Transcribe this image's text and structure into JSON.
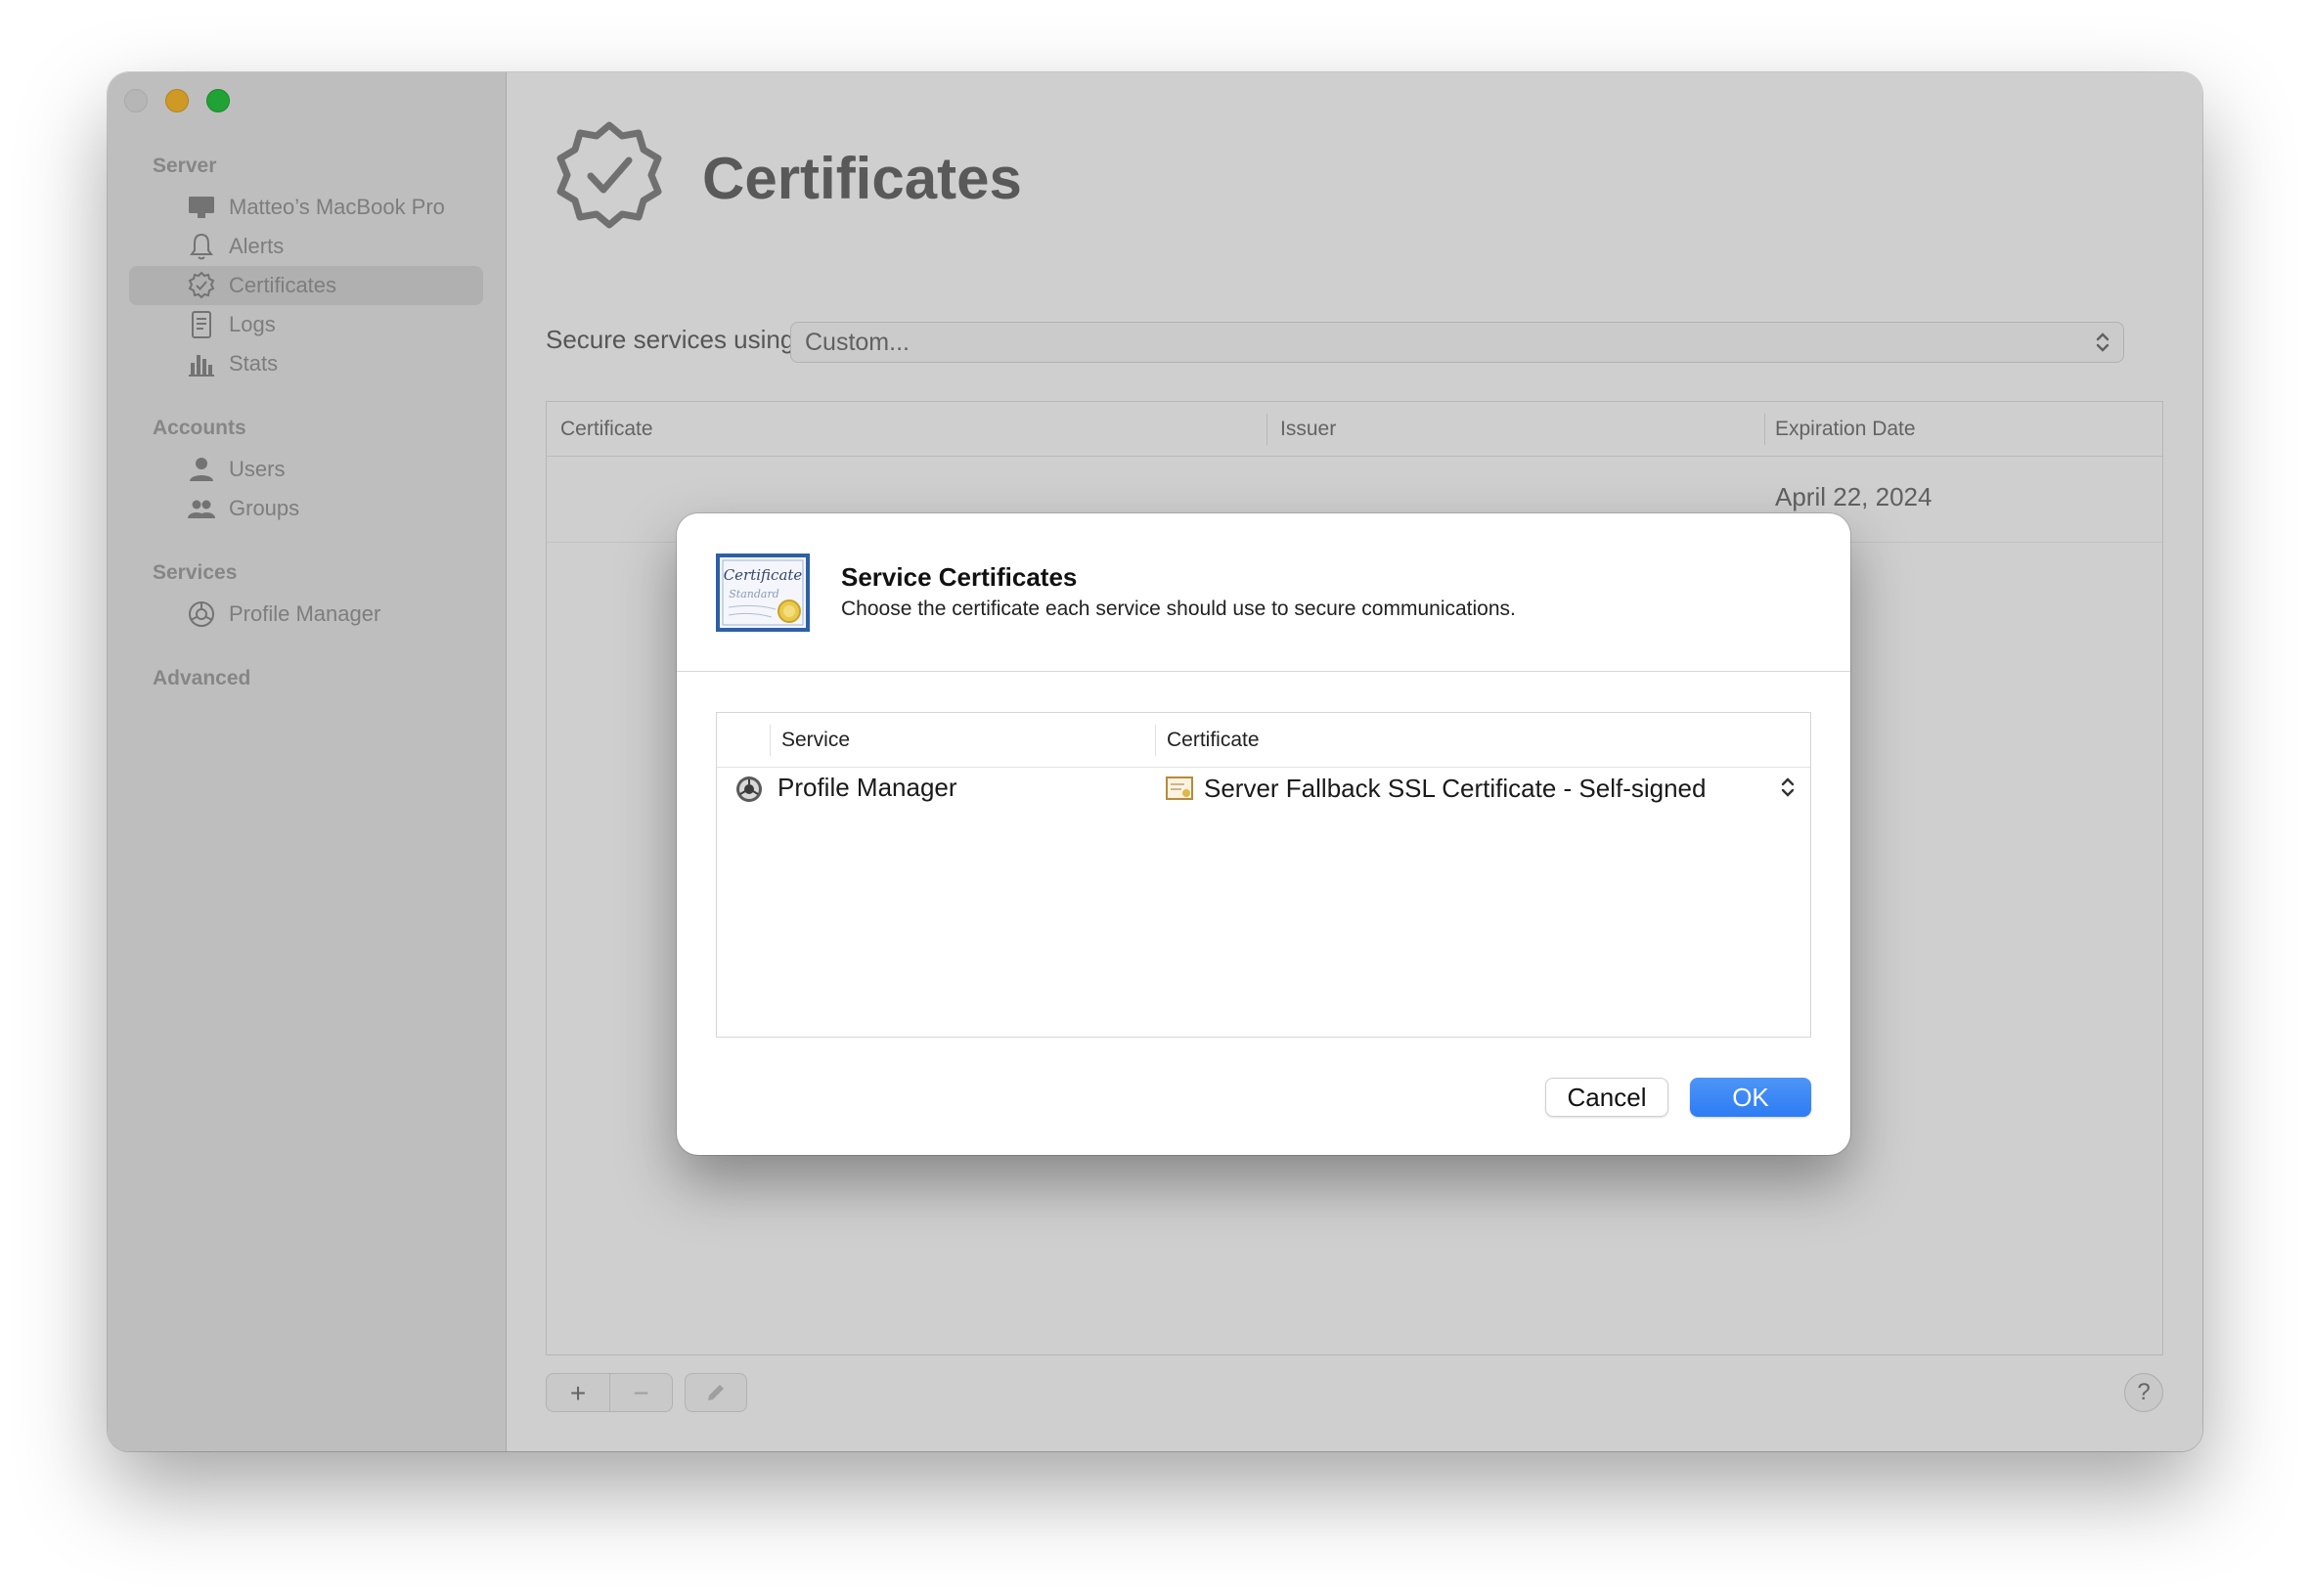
{
  "window": {
    "traffic_lights": [
      "close",
      "minimize",
      "zoom"
    ]
  },
  "sidebar": {
    "sections": [
      {
        "label": "Server",
        "items": [
          {
            "label": "Matteo’s MacBook Pro",
            "icon": "computer-icon"
          },
          {
            "label": "Alerts",
            "icon": "bell-icon"
          },
          {
            "label": "Certificates",
            "icon": "certificate-icon",
            "selected": true
          },
          {
            "label": "Logs",
            "icon": "document-icon"
          },
          {
            "label": "Stats",
            "icon": "bar-chart-icon"
          }
        ]
      },
      {
        "label": "Accounts",
        "items": [
          {
            "label": "Users",
            "icon": "user-icon"
          },
          {
            "label": "Groups",
            "icon": "group-icon"
          }
        ]
      },
      {
        "label": "Services",
        "items": [
          {
            "label": "Profile Manager",
            "icon": "profile-manager-icon"
          }
        ]
      },
      {
        "label": "Advanced",
        "items": []
      }
    ]
  },
  "main": {
    "title": "Certificates",
    "secure_services_label": "Secure services using:",
    "secure_services_value": "Custom...",
    "table": {
      "columns": [
        "Certificate",
        "Issuer",
        "Expiration Date"
      ],
      "rows": [
        {
          "expiration": "April 22, 2024"
        }
      ]
    },
    "bottom_bar": {
      "add": "+",
      "remove": "−",
      "help": "?"
    }
  },
  "dialog": {
    "title": "Service Certificates",
    "subtitle": "Choose the certificate each service should use to secure communications.",
    "table": {
      "columns": [
        "Service",
        "Certificate"
      ],
      "rows": [
        {
          "service": "Profile Manager",
          "certificate": "Server Fallback SSL Certificate - Self-signed"
        }
      ]
    },
    "cancel_label": "Cancel",
    "ok_label": "OK"
  },
  "colors": {
    "accent": "#2f7df4",
    "sidebar_bg": "#ebebeb",
    "traffic_min": "#ffbd2e",
    "traffic_max": "#28c840"
  }
}
